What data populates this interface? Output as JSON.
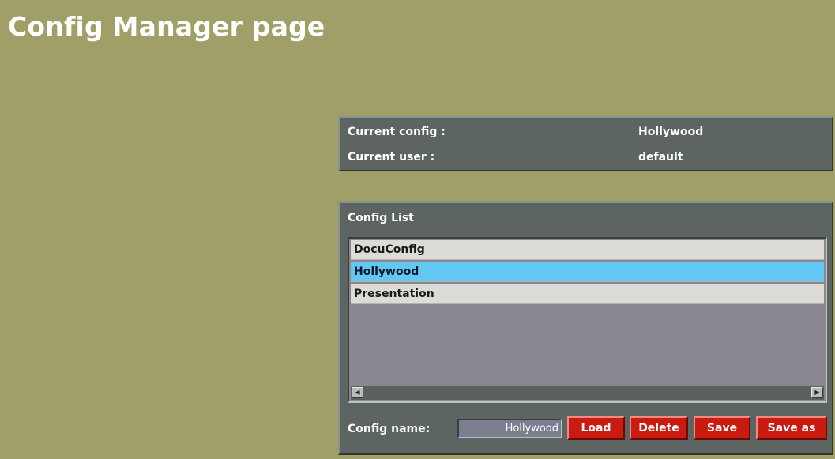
{
  "page": {
    "title": "Config Manager page"
  },
  "info": {
    "current_config_label": "Current config :",
    "current_config_value": "Hollywood",
    "current_user_label": "Current user :",
    "current_user_value": "default"
  },
  "config_list": {
    "title": "Config List",
    "items": [
      {
        "label": "DocuConfig",
        "selected": false
      },
      {
        "label": "Hollywood",
        "selected": true
      },
      {
        "label": "Presentation",
        "selected": false
      }
    ],
    "scroll_left_icon": "triangle-left-icon",
    "scroll_right_icon": "triangle-right-icon"
  },
  "form": {
    "config_name_label": "Config name:",
    "config_name_value": "Hollywood"
  },
  "buttons": {
    "load": "Load",
    "delete": "Delete",
    "save": "Save",
    "save_as": "Save as"
  },
  "colors": {
    "background": "#a09f67",
    "panel": "#5d6562",
    "selected_item": "#62c7f3",
    "button": "#c91b10"
  }
}
